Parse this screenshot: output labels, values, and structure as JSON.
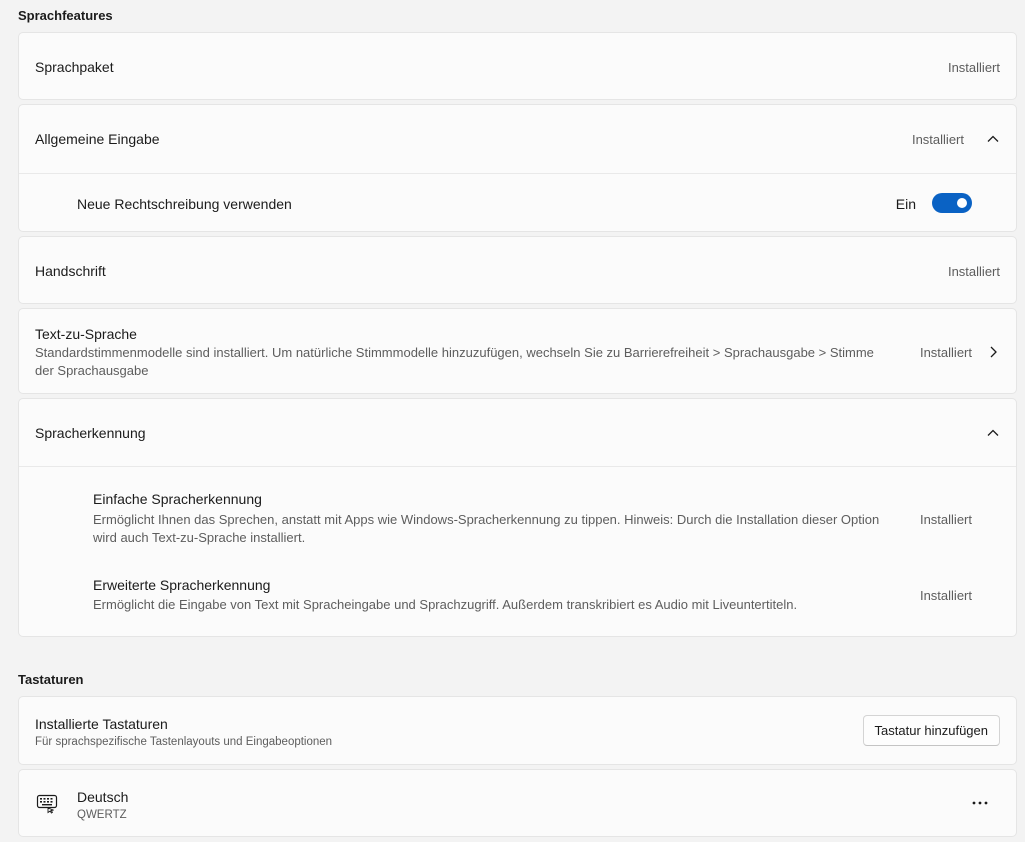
{
  "sections": {
    "features_title": "Sprachfeatures",
    "keyboards_title": "Tastaturen"
  },
  "language_pack": {
    "label": "Sprachpaket",
    "status": "Installiert"
  },
  "basic_typing": {
    "label": "Allgemeine Eingabe",
    "status": "Installiert",
    "spell_label": "Neue Rechtschreibung verwenden",
    "toggle_state": "Ein",
    "toggle_on": true
  },
  "handwriting": {
    "label": "Handschrift",
    "status": "Installiert"
  },
  "tts": {
    "label": "Text-zu-Sprache",
    "description": "Standardstimmenmodelle sind installiert. Um natürliche Stimmmodelle hinzuzufügen, wechseln Sie zu Barrierefreiheit > Sprachausgabe > Stimme der Sprachausgabe",
    "status": "Installiert"
  },
  "speech": {
    "label": "Spracherkennung",
    "basic": {
      "label": "Einfache Spracherkennung",
      "description": "Ermöglicht Ihnen das Sprechen, anstatt mit Apps wie Windows-Spracherkennung zu tippen. Hinweis: Durch die Installation dieser Option wird auch Text-zu-Sprache installiert.",
      "status": "Installiert"
    },
    "enhanced": {
      "label": "Erweiterte Spracherkennung",
      "description": "Ermöglicht die Eingabe von Text mit Spracheingabe und Sprachzugriff. Außerdem transkribiert es Audio mit Liveuntertiteln.",
      "status": "Installiert"
    }
  },
  "keyboards": {
    "installed_label": "Installierte Tastaturen",
    "installed_desc": "Für sprachspezifische Tastenlayouts und Eingabeoptionen",
    "add_button": "Tastatur hinzufügen",
    "item": {
      "name": "Deutsch",
      "layout": "QWERTZ",
      "icon": "keyboard-icon"
    }
  },
  "colors": {
    "accent": "#0a62c4"
  }
}
